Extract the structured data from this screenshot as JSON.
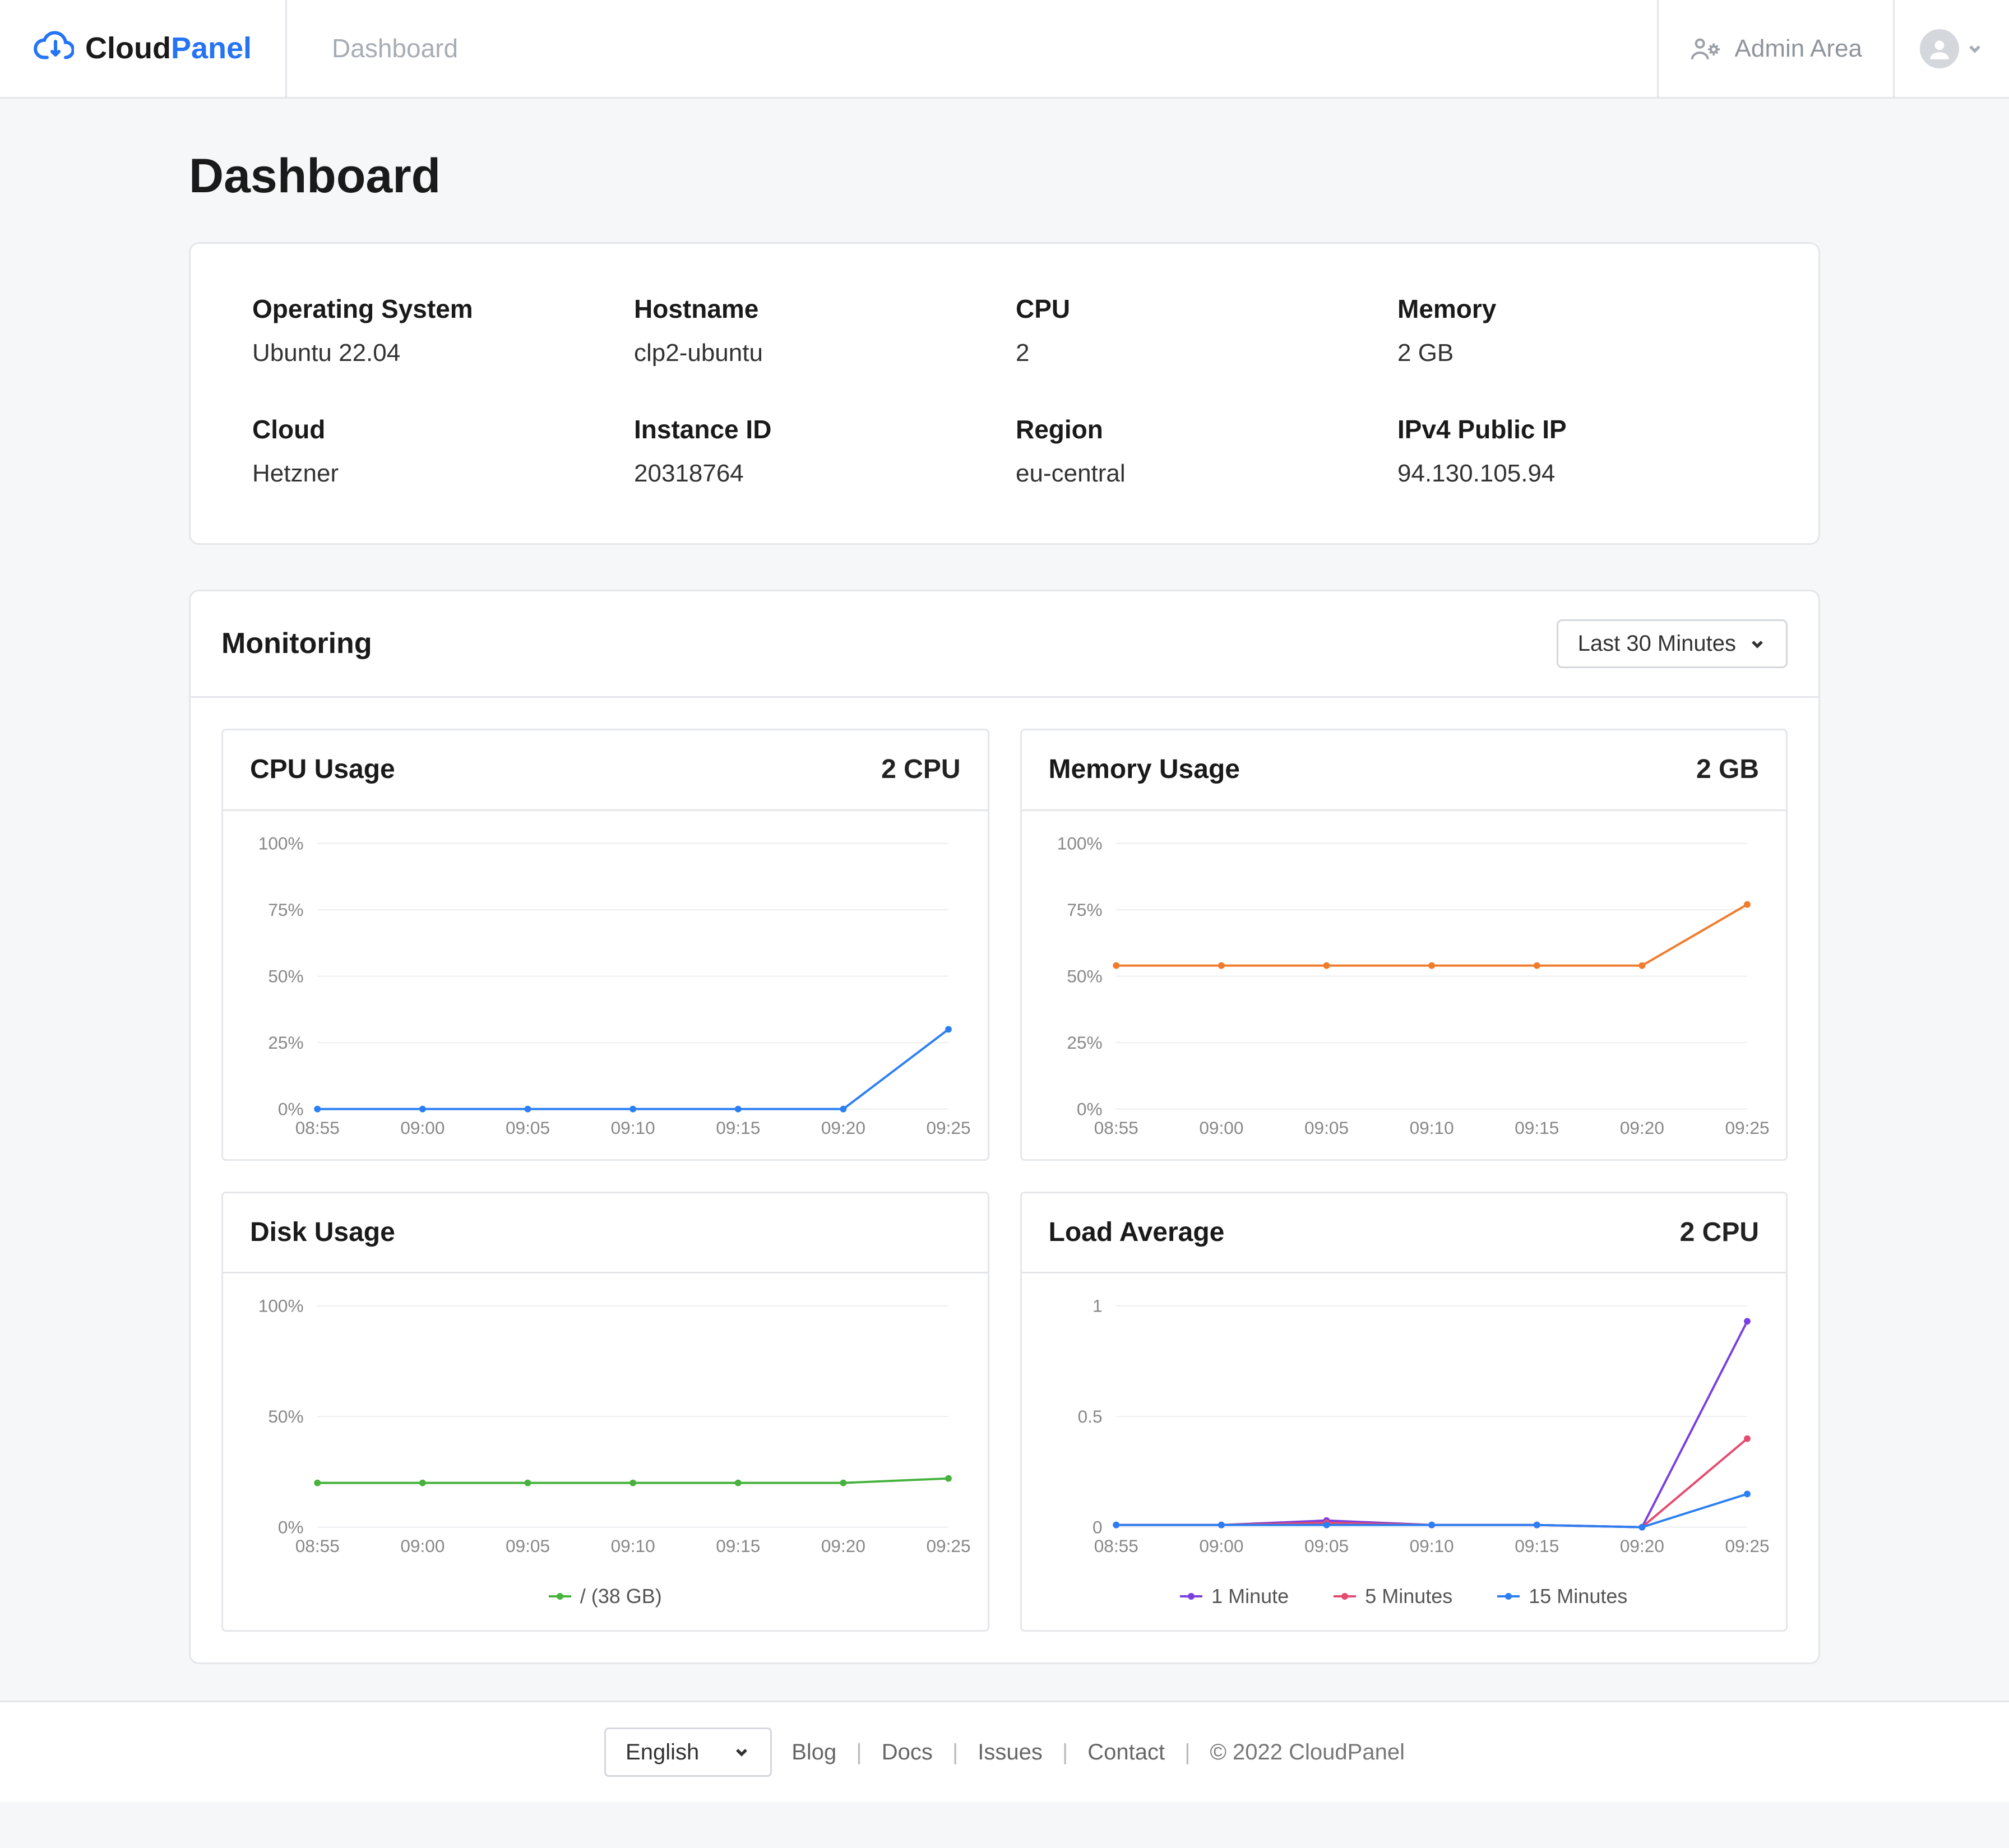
{
  "brand": {
    "cloud": "Cloud",
    "panel": "Panel"
  },
  "nav": {
    "dashboard": "Dashboard",
    "admin_area": "Admin Area"
  },
  "page_title": "Dashboard",
  "info": {
    "os": {
      "label": "Operating System",
      "value": "Ubuntu 22.04"
    },
    "hostname": {
      "label": "Hostname",
      "value": "clp2-ubuntu"
    },
    "cpu": {
      "label": "CPU",
      "value": "2"
    },
    "memory": {
      "label": "Memory",
      "value": "2 GB"
    },
    "cloud": {
      "label": "Cloud",
      "value": "Hetzner"
    },
    "instance": {
      "label": "Instance ID",
      "value": "20318764"
    },
    "region": {
      "label": "Region",
      "value": "eu-central"
    },
    "ip": {
      "label": "IPv4 Public IP",
      "value": "94.130.105.94"
    }
  },
  "monitoring": {
    "title": "Monitoring",
    "timerange": "Last 30 Minutes"
  },
  "charts": {
    "cpu": {
      "title": "CPU Usage",
      "right": "2 CPU"
    },
    "memory": {
      "title": "Memory Usage",
      "right": "2 GB"
    },
    "disk": {
      "title": "Disk Usage",
      "right": "",
      "legend0": "/ (38 GB)"
    },
    "load": {
      "title": "Load Average",
      "right": "2 CPU",
      "legend0": "1 Minute",
      "legend1": "5 Minutes",
      "legend2": "15 Minutes"
    }
  },
  "footer": {
    "language": "English",
    "blog": "Blog",
    "docs": "Docs",
    "issues": "Issues",
    "contact": "Contact",
    "copyright": "© 2022  CloudPanel"
  },
  "chart_data": [
    {
      "id": "cpu",
      "type": "line",
      "title": "CPU Usage",
      "ylabel": "%",
      "ylim": [
        0,
        100
      ],
      "yticks": [
        0,
        25,
        50,
        75,
        100
      ],
      "categories": [
        "08:55",
        "09:00",
        "09:05",
        "09:10",
        "09:15",
        "09:20",
        "09:25"
      ],
      "series": [
        {
          "name": "CPU",
          "color": "#2b7ff2",
          "values": [
            0,
            0,
            0,
            0,
            0,
            0,
            30
          ]
        }
      ]
    },
    {
      "id": "memory",
      "type": "line",
      "title": "Memory Usage",
      "ylabel": "%",
      "ylim": [
        0,
        100
      ],
      "yticks": [
        0,
        25,
        50,
        75,
        100
      ],
      "categories": [
        "08:55",
        "09:00",
        "09:05",
        "09:10",
        "09:15",
        "09:20",
        "09:25"
      ],
      "series": [
        {
          "name": "Memory",
          "color": "#f07b2a",
          "values": [
            54,
            54,
            54,
            54,
            54,
            54,
            77
          ]
        }
      ]
    },
    {
      "id": "disk",
      "type": "line",
      "title": "Disk Usage",
      "ylabel": "%",
      "ylim": [
        0,
        100
      ],
      "yticks": [
        0,
        50,
        100
      ],
      "categories": [
        "08:55",
        "09:00",
        "09:05",
        "09:10",
        "09:15",
        "09:20",
        "09:25"
      ],
      "series": [
        {
          "name": "/ (38 GB)",
          "color": "#47b23e",
          "values": [
            20,
            20,
            20,
            20,
            20,
            20,
            22
          ]
        }
      ]
    },
    {
      "id": "load",
      "type": "line",
      "title": "Load Average",
      "ylabel": "",
      "ylim": [
        0,
        1
      ],
      "yticks": [
        0,
        0.5,
        1
      ],
      "categories": [
        "08:55",
        "09:00",
        "09:05",
        "09:10",
        "09:15",
        "09:20",
        "09:25"
      ],
      "series": [
        {
          "name": "1 Minute",
          "color": "#7a3fe0",
          "values": [
            0.01,
            0.01,
            0.03,
            0.01,
            0.01,
            0.0,
            0.93
          ]
        },
        {
          "name": "5 Minutes",
          "color": "#e44b6f",
          "values": [
            0.01,
            0.01,
            0.02,
            0.01,
            0.01,
            0.0,
            0.4
          ]
        },
        {
          "name": "15 Minutes",
          "color": "#2b7ff2",
          "values": [
            0.01,
            0.01,
            0.01,
            0.01,
            0.01,
            0.0,
            0.15
          ]
        }
      ]
    }
  ]
}
